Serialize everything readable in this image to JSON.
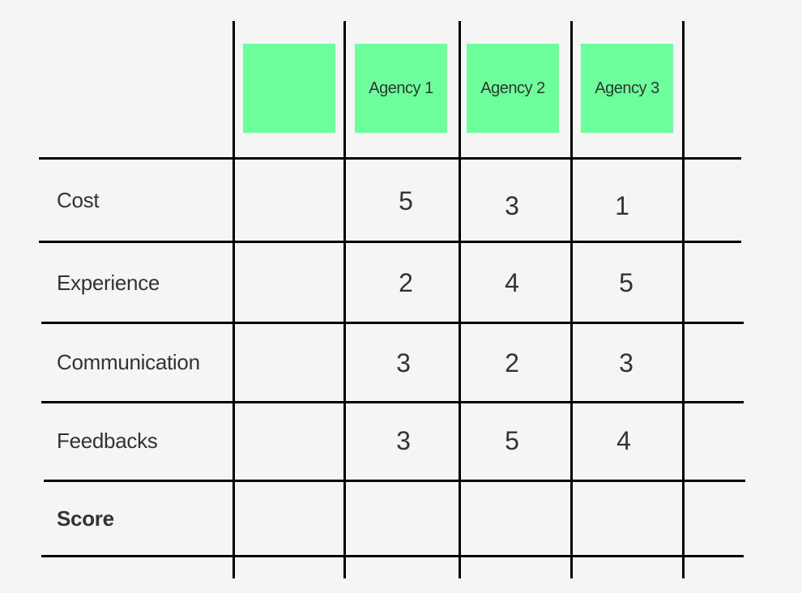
{
  "table": {
    "header_color": "#6cff9b",
    "columns": [
      "",
      "Agency 1",
      "Agency 2",
      "Agency 3"
    ],
    "rows": [
      {
        "label": "Cost",
        "values": [
          "5",
          "3",
          "1"
        ]
      },
      {
        "label": "Experience",
        "values": [
          "2",
          "4",
          "5"
        ]
      },
      {
        "label": "Communication",
        "values": [
          "3",
          "2",
          "3"
        ]
      },
      {
        "label": "Feedbacks",
        "values": [
          "3",
          "5",
          "4"
        ]
      },
      {
        "label": "Score",
        "values": [
          "",
          "",
          ""
        ]
      }
    ]
  }
}
